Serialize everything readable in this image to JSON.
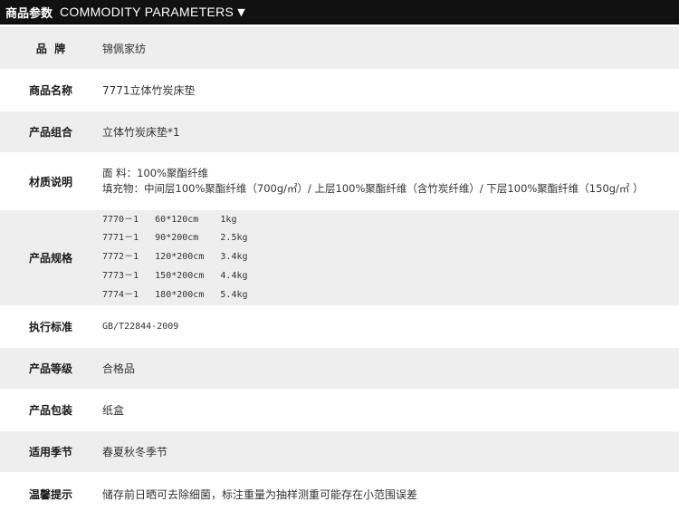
{
  "header": {
    "title_cn": "商品参数",
    "title_en": "COMMODITY PARAMETERS",
    "arrow": "▼"
  },
  "rows": {
    "brand": {
      "label": "品  牌",
      "value": "锦佩家纺"
    },
    "product_name": {
      "label": "商品名称",
      "value": "7771立体竹炭床垫"
    },
    "product_combo": {
      "label": "产品组合",
      "value": "立体竹炭床垫*1"
    },
    "material": {
      "label": "材质说明",
      "lines": [
        "面 料：100%聚酯纤维",
        "填充物：中间层100%聚酯纤维（700g/㎡）/ 上层100%聚酯纤维（含竹炭纤维）/ 下层100%聚酯纤维（150g/㎡ ）"
      ]
    },
    "spec": {
      "label": "产品规格",
      "lines": [
        "7770－1   60*120cm    1kg",
        "7771－1   90*200cm    2.5kg",
        "7772－1   120*200cm   3.4kg",
        "7773－1   150*200cm   4.4kg",
        "7774－1   180*200cm   5.4kg"
      ]
    },
    "standard": {
      "label": "执行标准",
      "value": "GB/T22844-2009"
    },
    "grade": {
      "label": "产品等级",
      "value": "合格品"
    },
    "packaging": {
      "label": "产品包装",
      "value": "纸盒"
    },
    "season": {
      "label": "适用季节",
      "value": "春夏秋冬季节"
    },
    "tips": {
      "label": "温馨提示",
      "value": "储存前日晒可去除细菌，标注重量为抽样测重可能存在小范围误差"
    }
  }
}
